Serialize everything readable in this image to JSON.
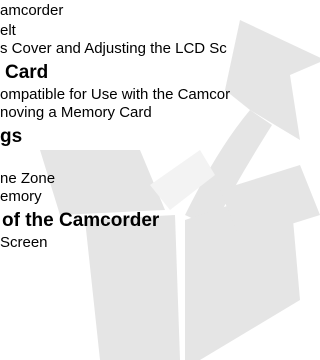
{
  "lines": [
    {
      "kind": "item",
      "text": "amcorder"
    },
    {
      "kind": "item",
      "text": "elt"
    },
    {
      "kind": "item",
      "text": "s Cover and Adjusting the LCD Sc"
    },
    {
      "kind": "heading",
      "text": "Card"
    },
    {
      "kind": "item",
      "text": "ompatible for Use with the Camcor"
    },
    {
      "kind": "item",
      "text": "noving a Memory Card"
    },
    {
      "kind": "heading",
      "text": "gs"
    },
    {
      "kind": "item",
      "text": "ne Zone"
    },
    {
      "kind": "item",
      "text": "emory"
    },
    {
      "kind": "heading",
      "text": "of the Camcorder"
    },
    {
      "kind": "item",
      "text": "Screen"
    }
  ],
  "watermark": {
    "icon": "box-with-arrow-icon",
    "color": "#e4e4e4"
  }
}
